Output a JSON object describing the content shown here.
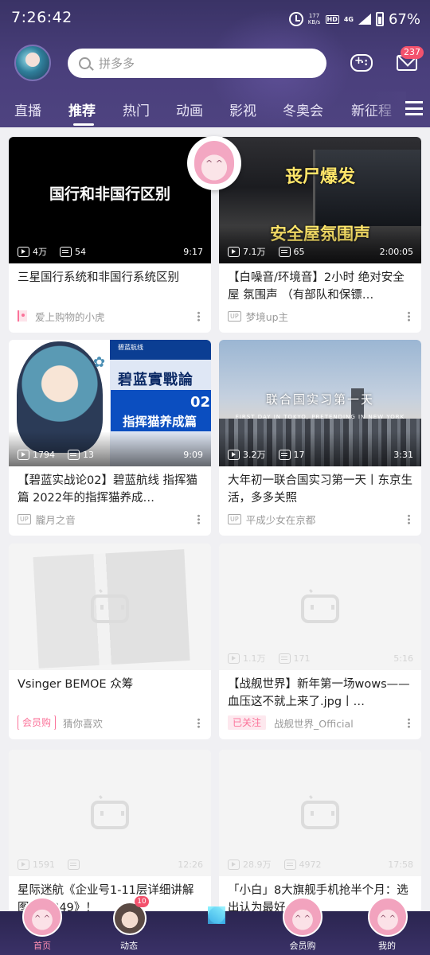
{
  "status_bar": {
    "time": "7:26:42",
    "net_speed_value": "177",
    "net_speed_unit": "KB/s",
    "hd_label": "HD",
    "network_label": "4G",
    "battery": "67%"
  },
  "header": {
    "search_placeholder": "拼多多",
    "mail_badge": "237",
    "tabs": [
      "直播",
      "推荐",
      "热门",
      "动画",
      "影视",
      "冬奥会",
      "新征程"
    ],
    "active_tab": "推荐"
  },
  "cards": [
    {
      "thumb_text": "国行和非国行区别",
      "views": "4万",
      "danmaku": "54",
      "duration": "9:17",
      "title": "三星国行系统和非国行系统区别",
      "author": "爱上购物的小虎"
    },
    {
      "thumb_text_top": "丧尸爆发",
      "thumb_text_bottom": "安全屋氛围声",
      "views": "7.1万",
      "danmaku": "65",
      "duration": "2:00:05",
      "title": "【白噪音/环境音】2小时 绝对安全屋 氛围声 （有部队和保镖…",
      "up_tag": "UP",
      "author": "梦境up主"
    },
    {
      "thumb_brand": "碧蓝航线",
      "thumb_title": "碧蓝實戰論",
      "thumb_num": "02",
      "thumb_sub": "指挥猫养成篇",
      "views": "1794",
      "danmaku": "13",
      "duration": "9:09",
      "title": "【碧蓝实战论02】碧蓝航线 指挥猫篇 2022年的指挥猫养成…",
      "up_tag": "UP",
      "author": "朧月之音"
    },
    {
      "thumb_title": "联合国实习第一天",
      "thumb_sub": "FIRST DAY IN TOKYO, PRETENDING IN NEW YORK",
      "views": "3.2万",
      "danmaku": "17",
      "duration": "3:31",
      "title": "大年初一联合国实习第一天丨东京生活，多多关照",
      "up_tag": "UP",
      "author": "平成少女在京都"
    },
    {
      "title": "Vsinger BEMOE 众筹",
      "tag": "会员购",
      "author": "猜你喜欢"
    },
    {
      "views": "1.1万",
      "danmaku": "171",
      "duration": "5:16",
      "title": "【战舰世界】新年第一场wows——血压这不就上来了.jpg丨…",
      "tag": "已关注",
      "author": "战舰世界_Official"
    },
    {
      "views": "1591",
      "danmaku": "",
      "duration": "12:26",
      "title": "星际迷航《企业号1-11层详细讲解图/海8849》！"
    },
    {
      "views": "28.9万",
      "danmaku": "4972",
      "duration": "17:58",
      "title": "「小白」8大旗舰手机抢半个月：选出认为最好…"
    }
  ],
  "bottom_nav": {
    "items": [
      "首页",
      "动态",
      "",
      "会员购",
      "我的"
    ],
    "active": "首页",
    "dynamic_badge": "10"
  }
}
